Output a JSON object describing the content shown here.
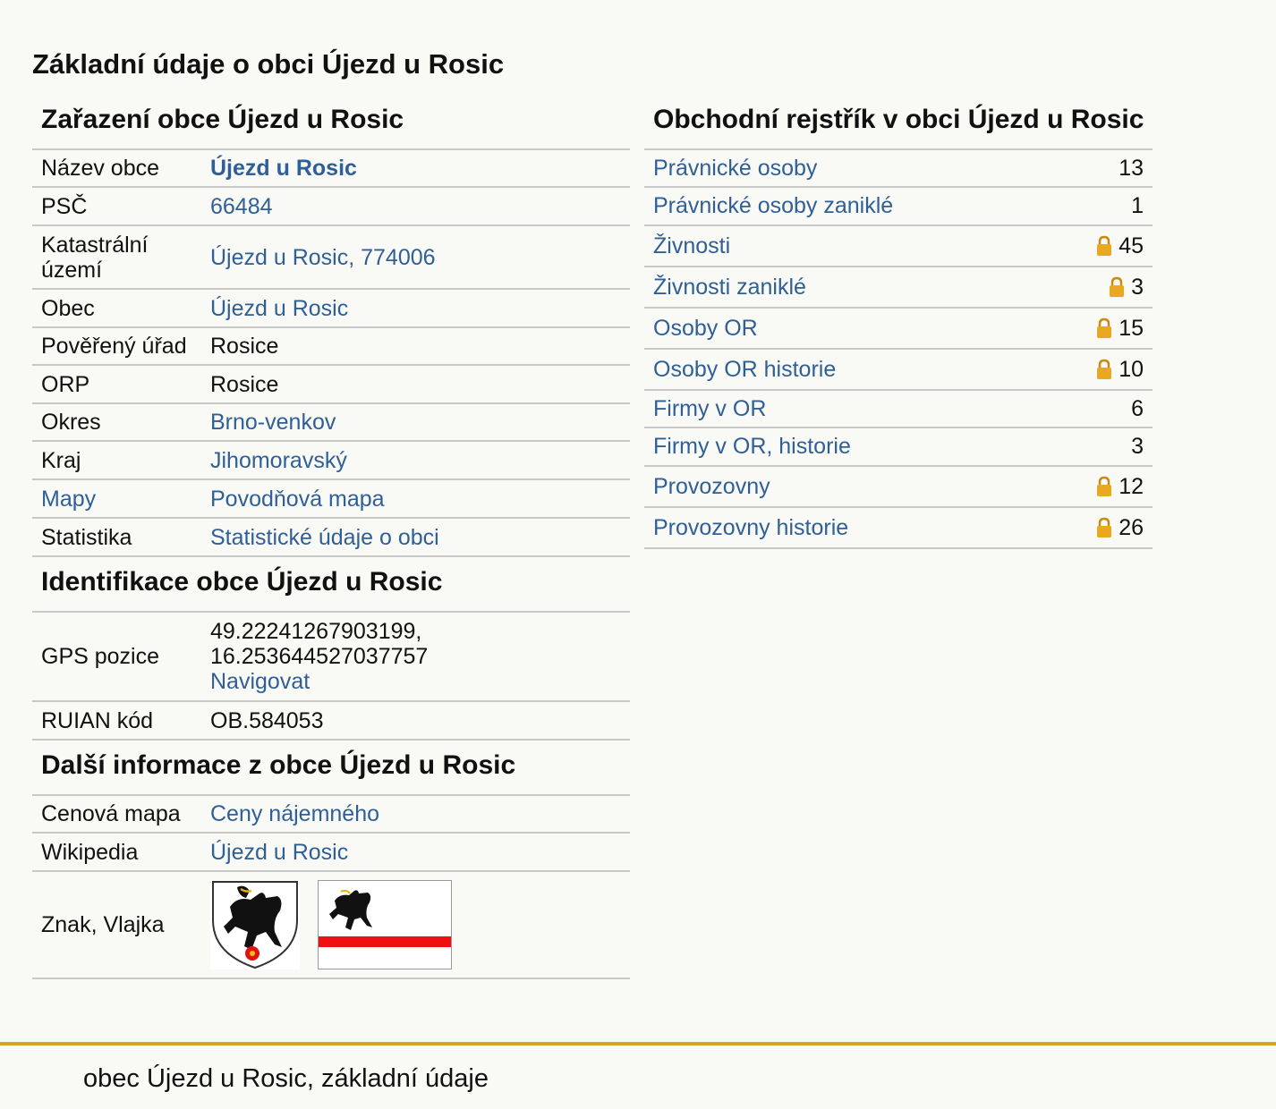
{
  "page_title": "Základní údaje o obci Újezd u Rosic",
  "classification": {
    "heading": "Zařazení obce Újezd u Rosic",
    "rows": [
      {
        "label": "Název obce",
        "value": "Újezd u Rosic",
        "link": true
      },
      {
        "label": "PSČ",
        "value": "66484",
        "link": true
      },
      {
        "label": "Katastrální území",
        "value": "Újezd u Rosic, 774006",
        "link": true
      },
      {
        "label": "Obec",
        "value": "Újezd u Rosic",
        "link": true
      },
      {
        "label": "Pověřený úřad",
        "value": "Rosice",
        "link": false
      },
      {
        "label": "ORP",
        "value": "Rosice",
        "link": false
      },
      {
        "label": "Okres",
        "value": "Brno-venkov",
        "link": true
      },
      {
        "label": "Kraj",
        "value": "Jihomoravský",
        "link": true
      },
      {
        "label": "Mapy",
        "value": "Povodňová mapa",
        "link": true
      },
      {
        "label": "Statistika",
        "value": "Statistické údaje o obci",
        "link": true
      }
    ]
  },
  "identification": {
    "heading": "Identifikace obce Újezd u Rosic",
    "gps_label": "GPS pozice",
    "gps_lat": "49.22241267903199,",
    "gps_lon": "16.253644527037757",
    "navigate_label": "Navigovat",
    "ruian_label": "RUIAN kód",
    "ruian_value": "OB.584053"
  },
  "more_info": {
    "heading": "Další informace z obce Újezd u Rosic",
    "price_map_label": "Cenová mapa",
    "price_map_value": "Ceny nájemného",
    "wikipedia_label": "Wikipedia",
    "wikipedia_value": "Újezd u Rosic",
    "emblem_label": "Znak, Vlajka"
  },
  "business_register": {
    "heading": "Obchodní rejstřík v obci Újezd u Rosic",
    "rows": [
      {
        "label": "Právnické osoby",
        "count": "13",
        "locked": false
      },
      {
        "label": "Právnické osoby zaniklé",
        "count": "1",
        "locked": false
      },
      {
        "label": "Živnosti",
        "count": "45",
        "locked": true
      },
      {
        "label": "Živnosti zaniklé",
        "count": "3",
        "locked": true
      },
      {
        "label": "Osoby OR",
        "count": "15",
        "locked": true
      },
      {
        "label": "Osoby OR historie",
        "count": "10",
        "locked": true
      },
      {
        "label": "Firmy v OR",
        "count": "6",
        "locked": false
      },
      {
        "label": "Firmy v OR, historie",
        "count": "3",
        "locked": false
      },
      {
        "label": "Provozovny",
        "count": "12",
        "locked": true
      },
      {
        "label": "Provozovny historie",
        "count": "26",
        "locked": true
      }
    ]
  },
  "footer": {
    "text": "obec Újezd u Rosic, základní údaje"
  },
  "colors": {
    "link": "#2f5f97",
    "footer_rule": "#d4a520",
    "flag_stripe": "#ee1111",
    "lock": "#e8a820"
  }
}
